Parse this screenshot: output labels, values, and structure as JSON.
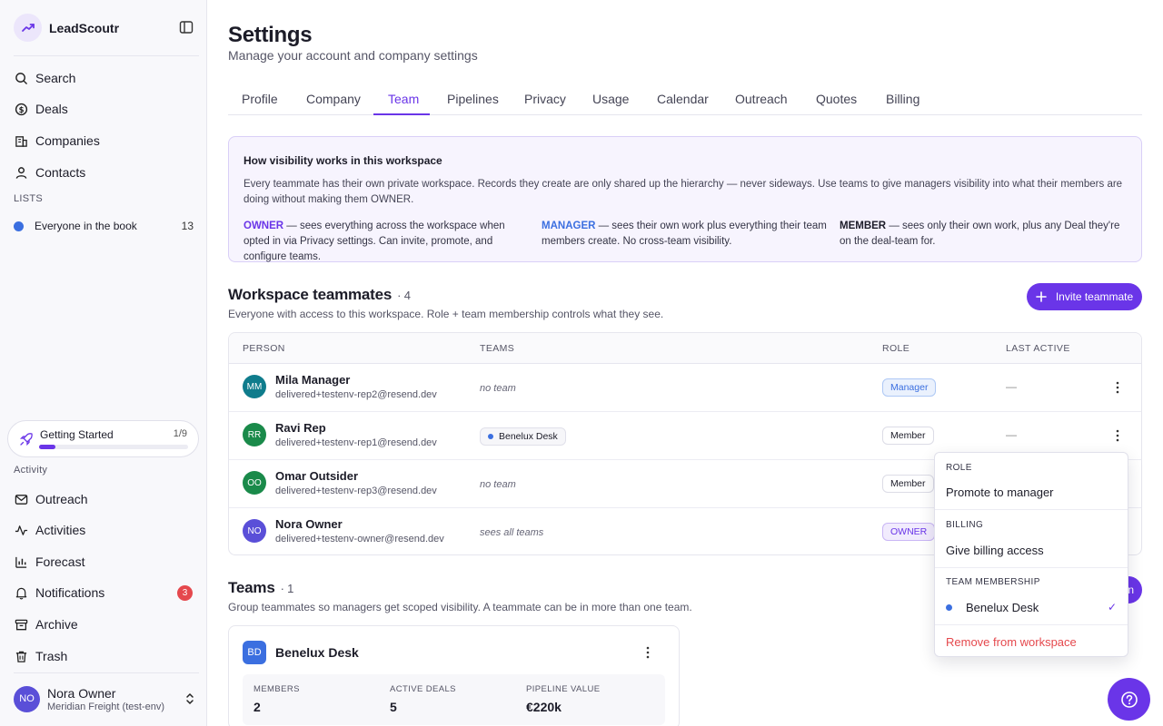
{
  "app": {
    "name": "LeadScoutr"
  },
  "nav": {
    "search": "Search",
    "deals": "Deals",
    "companies": "Companies",
    "contacts": "Contacts"
  },
  "lists": {
    "section_label": "LISTS",
    "items": [
      {
        "label": "Everyone in the book",
        "count": "13"
      }
    ]
  },
  "getting_started": {
    "label": "Getting Started",
    "count": "1/9",
    "progress": 0.11
  },
  "activity": {
    "section_label": "Activity",
    "outreach": "Outreach",
    "activities": "Activities",
    "forecast": "Forecast",
    "notifications": "Notifications",
    "notifications_count": "3",
    "archive": "Archive",
    "trash": "Trash"
  },
  "user": {
    "initials": "NO",
    "name": "Nora Owner",
    "org": "Meridian Freight (test-env)"
  },
  "page": {
    "title": "Settings",
    "subtitle": "Manage your account and company settings"
  },
  "tabs": [
    {
      "label": "Profile"
    },
    {
      "label": "Company"
    },
    {
      "label": "Team",
      "active": true
    },
    {
      "label": "Pipelines"
    },
    {
      "label": "Privacy"
    },
    {
      "label": "Usage"
    },
    {
      "label": "Calendar"
    },
    {
      "label": "Outreach"
    },
    {
      "label": "Quotes"
    },
    {
      "label": "Billing"
    }
  ],
  "visibility": {
    "title": "How visibility works in this workspace",
    "body": "Every teammate has their own private workspace. Records they create are only shared up the hierarchy — never sideways. Use teams to give managers visibility into what their members are doing without making them OWNER.",
    "owner_role": "OWNER",
    "owner_text": " — sees everything across the workspace when opted in via Privacy settings. Can invite, promote, and configure teams.",
    "manager_role": "MANAGER",
    "manager_text": " — sees their own work plus everything their team members create. No cross-team visibility.",
    "member_role": "MEMBER",
    "member_text": " — sees only their own work, plus any Deal they're on the deal-team for."
  },
  "teammates": {
    "title": "Workspace teammates",
    "count": "· 4",
    "subtitle": "Everyone with access to this workspace. Role + team membership controls what they see.",
    "invite_label": "Invite teammate",
    "columns": {
      "person": "PERSON",
      "teams": "TEAMS",
      "role": "ROLE",
      "last_active": "LAST ACTIVE"
    },
    "rows": [
      {
        "initials": "MM",
        "name": "Mila Manager",
        "email": "delivered+testenv-rep2@resend.dev",
        "team": "no team",
        "role": "Manager",
        "last_active": "—",
        "avatar_color": "#0f7c8c"
      },
      {
        "initials": "RR",
        "name": "Ravi Rep",
        "email": "delivered+testenv-rep1@resend.dev",
        "team_chip": "Benelux Desk",
        "role": "Member",
        "last_active": "—",
        "avatar_color": "#1a8a4a"
      },
      {
        "initials": "OO",
        "name": "Omar Outsider",
        "email": "delivered+testenv-rep3@resend.dev",
        "team": "no team",
        "role": "Member",
        "last_active": "",
        "avatar_color": "#1a8a4a"
      },
      {
        "initials": "NO",
        "name": "Nora Owner",
        "email": "delivered+testenv-owner@resend.dev",
        "team": "sees all teams",
        "role": "OWNER",
        "last_active": "",
        "avatar_color": "#5a4fd8"
      }
    ]
  },
  "teams": {
    "title": "Teams",
    "count": "· 1",
    "subtitle": "Group teammates so managers get scoped visibility. A teammate can be in more than one team.",
    "card": {
      "initials": "BD",
      "name": "Benelux Desk",
      "members_label": "MEMBERS",
      "members": "2",
      "deals_label": "ACTIVE DEALS",
      "deals": "5",
      "pipeline_label": "PIPELINE VALUE",
      "pipeline": "€220k"
    }
  },
  "row_menu": {
    "role_label": "ROLE",
    "promote": "Promote to manager",
    "billing_label": "BILLING",
    "billing": "Give billing access",
    "membership_label": "TEAM MEMBERSHIP",
    "membership_team": "Benelux Desk",
    "membership_check": "✓",
    "remove": "Remove from workspace"
  },
  "colors": {
    "accent": "#6a35e8",
    "blue": "#3b6fe0",
    "danger": "#e5484d"
  }
}
